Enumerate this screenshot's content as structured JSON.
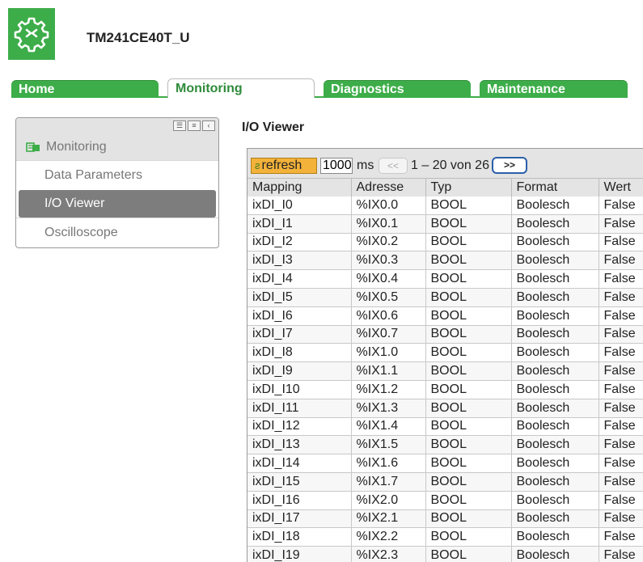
{
  "header": {
    "device_name": "TM241CE40T_U",
    "logo_icon": "gear-icon"
  },
  "tabs": [
    {
      "label": "Home",
      "active": false
    },
    {
      "label": "Monitoring",
      "active": true
    },
    {
      "label": "Diagnostics",
      "active": false
    },
    {
      "label": "Maintenance",
      "active": false
    }
  ],
  "sidebar": {
    "title": "Monitoring",
    "title_icon": "monitoring-icon",
    "controls": [
      "☰",
      "≡",
      "‹"
    ],
    "items": [
      {
        "label": "Data Parameters",
        "active": false
      },
      {
        "label": "I/O Viewer",
        "active": true
      },
      {
        "label": "Oscilloscope",
        "active": false
      }
    ]
  },
  "page": {
    "title": "I/O Viewer"
  },
  "toolbar": {
    "refresh_label": "refresh",
    "refresh_icon": "refresh-icon",
    "interval_value": "1000",
    "interval_unit": "ms",
    "prev_label": "<<",
    "page_info": "1 – 20 von 26",
    "next_label": ">>"
  },
  "table": {
    "headers": [
      "Mapping",
      "Adresse",
      "Typ",
      "Format",
      "Wert"
    ],
    "rows": [
      [
        "ixDI_I0",
        "%IX0.0",
        "BOOL",
        "Boolesch",
        "False"
      ],
      [
        "ixDI_I1",
        "%IX0.1",
        "BOOL",
        "Boolesch",
        "False"
      ],
      [
        "ixDI_I2",
        "%IX0.2",
        "BOOL",
        "Boolesch",
        "False"
      ],
      [
        "ixDI_I3",
        "%IX0.3",
        "BOOL",
        "Boolesch",
        "False"
      ],
      [
        "ixDI_I4",
        "%IX0.4",
        "BOOL",
        "Boolesch",
        "False"
      ],
      [
        "ixDI_I5",
        "%IX0.5",
        "BOOL",
        "Boolesch",
        "False"
      ],
      [
        "ixDI_I6",
        "%IX0.6",
        "BOOL",
        "Boolesch",
        "False"
      ],
      [
        "ixDI_I7",
        "%IX0.7",
        "BOOL",
        "Boolesch",
        "False"
      ],
      [
        "ixDI_I8",
        "%IX1.0",
        "BOOL",
        "Boolesch",
        "False"
      ],
      [
        "ixDI_I9",
        "%IX1.1",
        "BOOL",
        "Boolesch",
        "False"
      ],
      [
        "ixDI_I10",
        "%IX1.2",
        "BOOL",
        "Boolesch",
        "False"
      ],
      [
        "ixDI_I11",
        "%IX1.3",
        "BOOL",
        "Boolesch",
        "False"
      ],
      [
        "ixDI_I12",
        "%IX1.4",
        "BOOL",
        "Boolesch",
        "False"
      ],
      [
        "ixDI_I13",
        "%IX1.5",
        "BOOL",
        "Boolesch",
        "False"
      ],
      [
        "ixDI_I14",
        "%IX1.6",
        "BOOL",
        "Boolesch",
        "False"
      ],
      [
        "ixDI_I15",
        "%IX1.7",
        "BOOL",
        "Boolesch",
        "False"
      ],
      [
        "ixDI_I16",
        "%IX2.0",
        "BOOL",
        "Boolesch",
        "False"
      ],
      [
        "ixDI_I17",
        "%IX2.1",
        "BOOL",
        "Boolesch",
        "False"
      ],
      [
        "ixDI_I18",
        "%IX2.2",
        "BOOL",
        "Boolesch",
        "False"
      ],
      [
        "ixDI_I19",
        "%IX2.3",
        "BOOL",
        "Boolesch",
        "False"
      ]
    ]
  },
  "colors": {
    "brand_green": "#3dad49",
    "refresh_orange": "#f3b23a",
    "active_menu": "#7d7d7d",
    "next_border": "#2a5fa8"
  }
}
